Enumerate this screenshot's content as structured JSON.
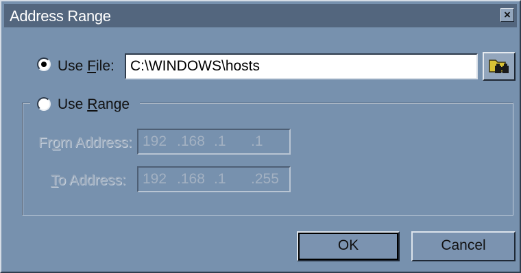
{
  "window": {
    "title": "Address Range",
    "close_glyph": "×"
  },
  "use_file": {
    "selected": true,
    "label_pre": "Use ",
    "label_acc": "F",
    "label_post": "ile:",
    "value": "C:\\WINDOWS\\hosts",
    "browse_icon": "folder-binoculars-icon"
  },
  "use_range": {
    "selected": false,
    "label_pre": "Use ",
    "label_acc": "R",
    "label_post": "ange",
    "from": {
      "label_pre": "Fr",
      "label_acc": "o",
      "label_post": "m Address:",
      "octets": [
        "192",
        ".168",
        ".1",
        ".1"
      ]
    },
    "to": {
      "label_pre": "",
      "label_acc": "T",
      "label_post": "o Address:",
      "octets": [
        "192",
        ".168",
        ".1",
        ".255"
      ]
    }
  },
  "buttons": {
    "ok": "OK",
    "cancel": "Cancel"
  },
  "colors": {
    "face": "#7791ae",
    "title": "#53667e",
    "disabled_text": "#9aa9bb"
  }
}
